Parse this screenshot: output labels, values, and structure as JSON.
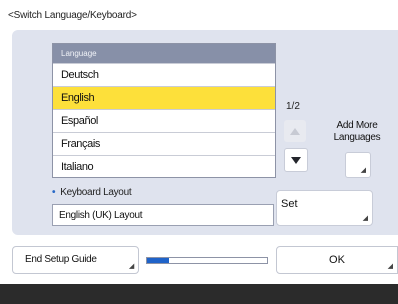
{
  "screen": {
    "title": "<Switch Language/Keyboard>"
  },
  "language_list": {
    "header": "Language",
    "items": [
      {
        "label": "Deutsch",
        "selected": false
      },
      {
        "label": "English",
        "selected": true
      },
      {
        "label": "Español",
        "selected": false
      },
      {
        "label": "Français",
        "selected": false
      },
      {
        "label": "Italiano",
        "selected": false
      }
    ],
    "page_indicator": "1/2"
  },
  "add_more": {
    "label_line1": "Add More",
    "label_line2": "Languages"
  },
  "keyboard": {
    "label": "Keyboard Layout",
    "value": "English (UK) Layout",
    "set_label": "Set"
  },
  "footer": {
    "end_setup_label": "End Setup Guide",
    "ok_label": "OK",
    "progress": 0.18
  },
  "colors": {
    "accent": "#1f63c9",
    "selection": "#fde03a",
    "panel": "#dfe3ee",
    "list_header": "#8790a8"
  },
  "icons": [
    "scroll-up-icon",
    "scroll-down-icon",
    "corner-arrow-icon"
  ]
}
